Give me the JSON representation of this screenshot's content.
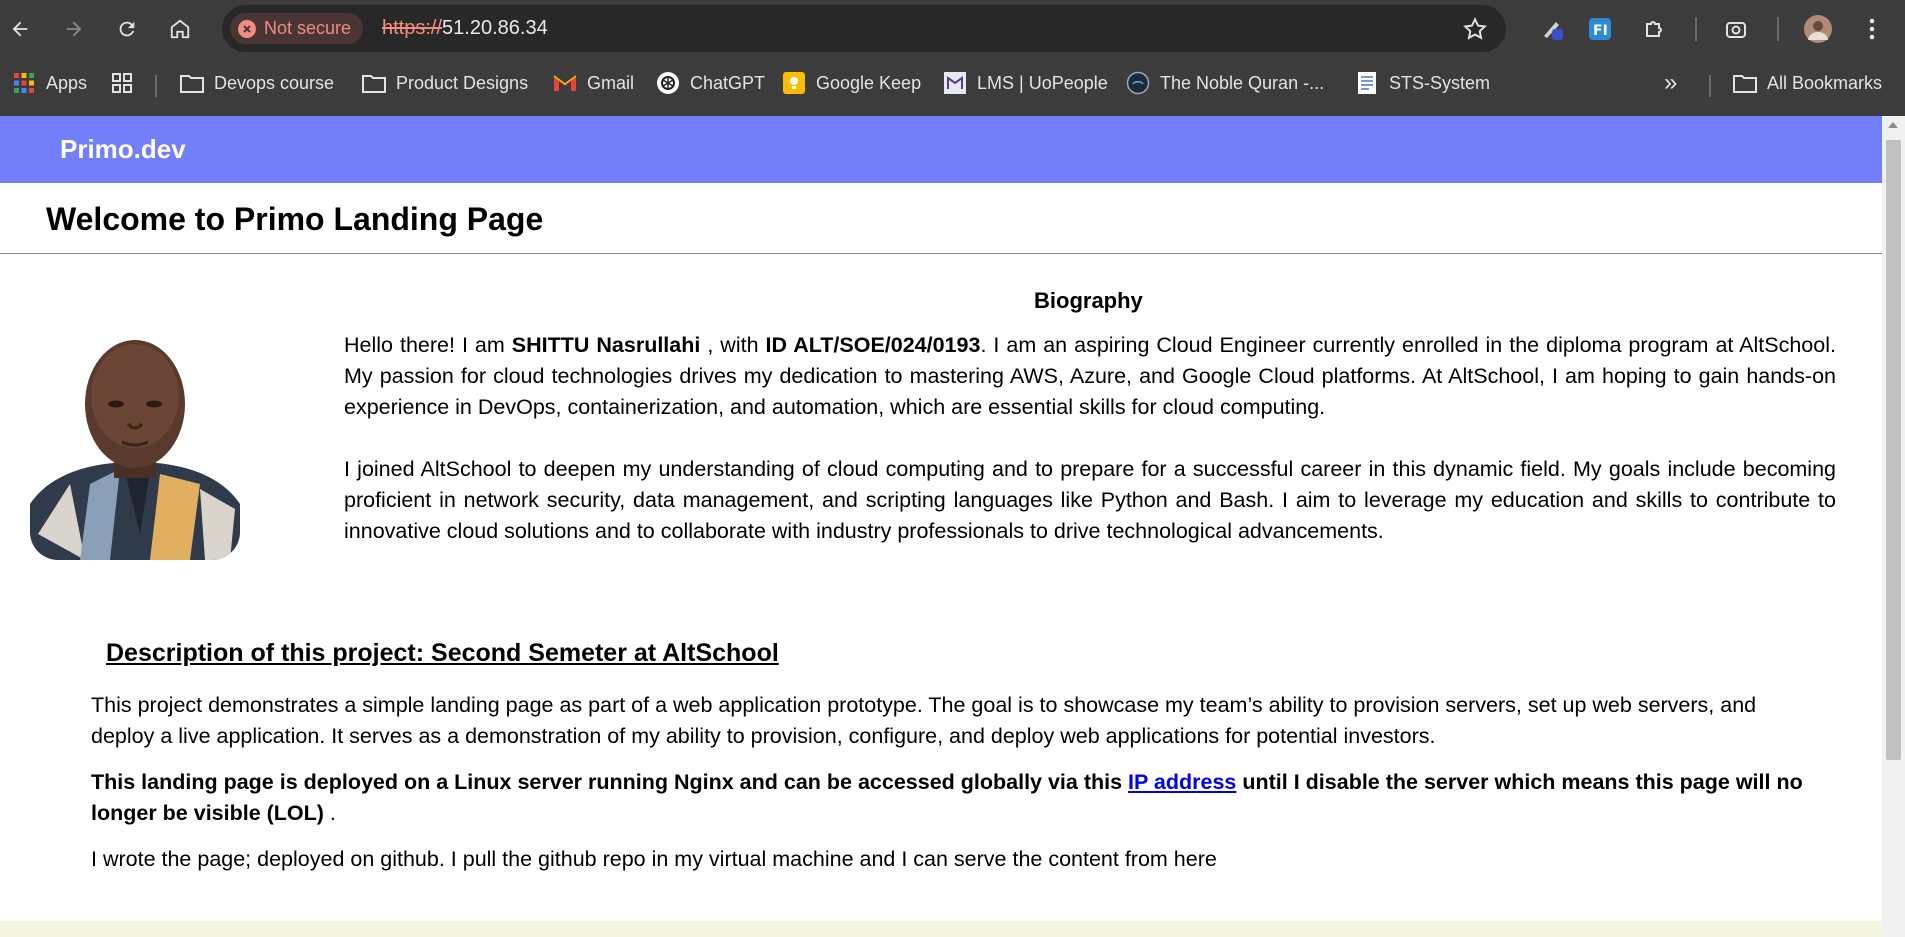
{
  "browser": {
    "security_label": "Not secure",
    "url_scheme": "https://",
    "url_host": "51.20.86.34",
    "bookmarks": [
      {
        "label": "Apps",
        "icon": "apps-grid-icon"
      },
      {
        "label": "",
        "icon": "tab-groups-icon"
      },
      {
        "label": "Devops course",
        "icon": "folder-icon"
      },
      {
        "label": "Product Designs",
        "icon": "folder-icon"
      },
      {
        "label": "Gmail",
        "icon": "gmail-icon"
      },
      {
        "label": "ChatGPT",
        "icon": "chatgpt-icon"
      },
      {
        "label": "Google Keep",
        "icon": "keep-icon"
      },
      {
        "label": "LMS | UoPeople",
        "icon": "lms-icon"
      },
      {
        "label": "The Noble Quran -...",
        "icon": "quran-icon"
      },
      {
        "label": "STS-System",
        "icon": "document-icon"
      }
    ],
    "overflow_label": "»",
    "all_bookmarks_label": "All Bookmarks"
  },
  "site": {
    "brand": "Primo.dev",
    "title": "Welcome to Primo Landing Page",
    "bio_heading": "Biography",
    "bio_p1_intro": "Hello there! I am ",
    "bio_p1_name": "SHITTU Nasrullahi",
    "bio_p1_with": " , with ",
    "bio_p1_id": "ID ALT/SOE/024/0193",
    "bio_p1_rest": ". I am an aspiring Cloud Engineer currently enrolled in the diploma program at AltSchool. My passion for cloud technologies drives my dedication to mastering AWS, Azure, and Google Cloud platforms. At AltSchool, I am hoping to gain hands-on experience in DevOps, containerization, and automation, which are essential skills for cloud computing.",
    "bio_p2": "I joined AltSchool to deepen my understanding of cloud computing and to prepare for a successful career in this dynamic field. My goals include becoming proficient in network security, data management, and scripting languages like Python and Bash. I aim to leverage my education and skills to contribute to innovative cloud solutions and to collaborate with industry professionals to drive technological advancements.",
    "desc_heading": "Description of this project: Second Semeter at AltSchool",
    "desc_p1": "This project demonstrates a simple landing page as part of a web application prototype. The goal is to showcase my team’s ability to provision servers, set up web servers, and deploy a live application. It serves as a demonstration of my ability to provision, configure, and deploy web applications for potential investors.",
    "desc_p2_before": "This landing page is deployed on a Linux server running Nginx and can be accessed globally via this ",
    "desc_p2_link": "IP address",
    "desc_p2_after": " until I disable the server which means this page will no longer be visible (LOL)",
    "desc_p2_tail": " .",
    "desc_p3": "I wrote the page; deployed on github. I pull the github repo in my virtual machine and I can serve the content from here"
  },
  "colors": {
    "header_bg": "#737ffa",
    "chrome_bg": "#3c3c3c",
    "link": "#0000ee"
  }
}
